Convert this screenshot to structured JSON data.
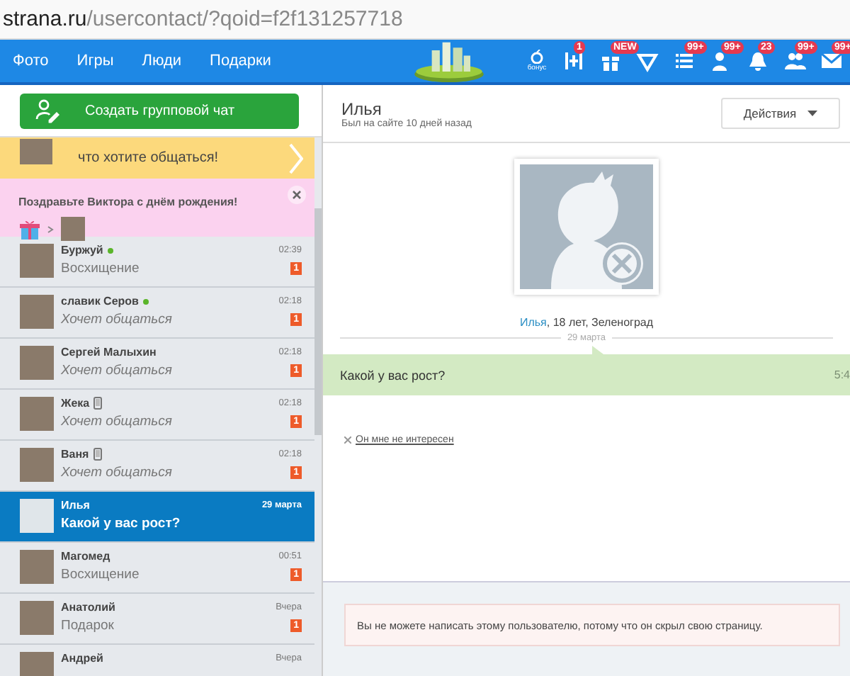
{
  "address_bar": {
    "domain": "strana.ru",
    "path": "/usercontact/?qoid=f2f131257718"
  },
  "nav": {
    "links": [
      "Фото",
      "Игры",
      "Люди",
      "Подарки"
    ],
    "icons": [
      {
        "kind": "bonus",
        "label": "бонус"
      },
      {
        "kind": "tuner",
        "badge": "1"
      },
      {
        "kind": "gift",
        "badge": "NEW"
      },
      {
        "kind": "diamond"
      },
      {
        "kind": "list",
        "badge": "99+"
      },
      {
        "kind": "person",
        "badge": "99+"
      },
      {
        "kind": "bell",
        "badge": "23"
      },
      {
        "kind": "people",
        "badge": "99+"
      },
      {
        "kind": "mail",
        "badge": "99+"
      }
    ]
  },
  "sidebar": {
    "create_button": "Создать групповой чат",
    "promo": {
      "text": "что хотите общаться!"
    },
    "birthday": {
      "text": "Поздравьте Виктора с днём рождения!"
    },
    "chats": [
      {
        "name": "Буржуй",
        "online": true,
        "mobile": false,
        "time": "02:39",
        "kind": "message",
        "preview": "Восхищение",
        "unread": "1",
        "selected": false
      },
      {
        "name": "славик Серов",
        "online": true,
        "mobile": false,
        "time": "02:18",
        "kind": "request",
        "preview": "Хочет общаться",
        "unread": "1",
        "selected": false
      },
      {
        "name": "Сергей Малыхин",
        "online": false,
        "mobile": false,
        "time": "02:18",
        "kind": "request",
        "preview": "Хочет общаться",
        "unread": "1",
        "selected": false
      },
      {
        "name": "Жека",
        "online": false,
        "mobile": true,
        "time": "02:18",
        "kind": "request",
        "preview": "Хочет общаться",
        "unread": "1",
        "selected": false
      },
      {
        "name": "Ваня",
        "online": false,
        "mobile": true,
        "time": "02:18",
        "kind": "request",
        "preview": "Хочет общаться",
        "unread": "1",
        "selected": false
      },
      {
        "name": "Илья",
        "online": false,
        "mobile": false,
        "time": "29 марта",
        "kind": "message",
        "preview": "Какой у вас рост?",
        "selected": true
      },
      {
        "name": "Магомед",
        "online": false,
        "mobile": false,
        "time": "00:51",
        "kind": "message",
        "preview": "Восхищение",
        "unread": "1",
        "selected": false
      },
      {
        "name": "Анатолий",
        "online": false,
        "mobile": false,
        "time": "Вчера",
        "kind": "message",
        "preview": "Подарок",
        "unread": "1",
        "selected": false
      },
      {
        "name": "Андрей",
        "online": false,
        "mobile": false,
        "time": "Вчера",
        "selected": false
      }
    ]
  },
  "conversation": {
    "name": "Илья",
    "last_seen": "Был на сайте 10 дней назад",
    "actions_button": "Действия",
    "profile": {
      "name": "Илья",
      "details": ", 18 лет, Зеленоград"
    },
    "date_divider": "29 марта",
    "messages": [
      {
        "text": "Какой у вас рост?",
        "time": "5:4"
      }
    ],
    "dismiss_link": "Он мне не интересен",
    "notice": "Вы не можете написать этому пользователю, потому что он скрыл свою страницу."
  }
}
